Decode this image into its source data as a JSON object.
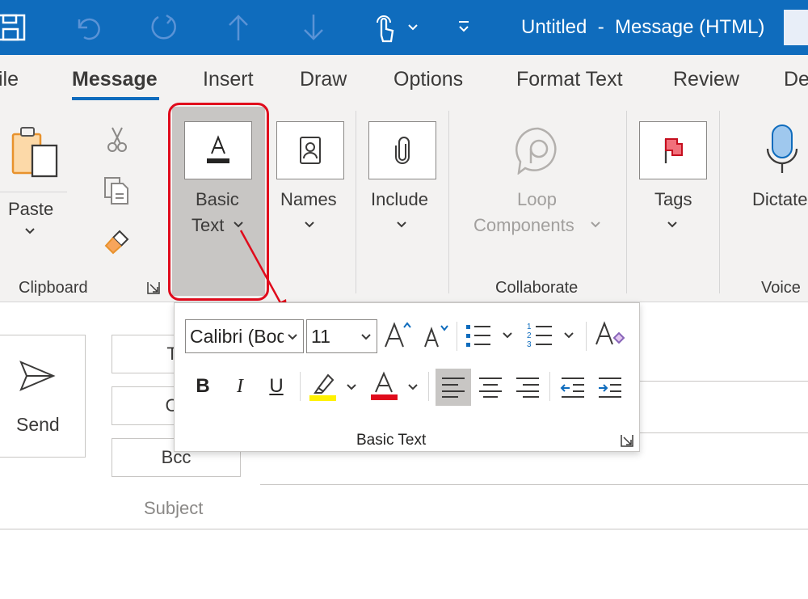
{
  "window": {
    "title": "Untitled  -  Message (HTML)"
  },
  "tabs": [
    {
      "label": "ile",
      "active": false
    },
    {
      "label": "Message",
      "active": true
    },
    {
      "label": "Insert",
      "active": false
    },
    {
      "label": "Draw",
      "active": false
    },
    {
      "label": "Options",
      "active": false
    },
    {
      "label": "Format Text",
      "active": false
    },
    {
      "label": "Review",
      "active": false
    },
    {
      "label": "De",
      "active": false
    }
  ],
  "ribbon": {
    "paste_label": "Paste",
    "clipboard_group": "Clipboard",
    "basic_text_line1": "Basic",
    "basic_text_line2": "Text",
    "names_label": "Names",
    "include_label": "Include",
    "loop_line1": "Loop",
    "loop_line2": "Components",
    "collaborate_group": "Collaborate",
    "tags_label": "Tags",
    "dictate_label": "Dictate",
    "voice_group": "Voice"
  },
  "compose": {
    "send_label": "Send",
    "to_label": "To",
    "cc_label": "Cc",
    "bcc_label": "Bcc",
    "subject_label": "Subject"
  },
  "popup": {
    "font_name": "Calibri (Body)",
    "font_size": "11",
    "group_label": "Basic Text"
  },
  "colors": {
    "titlebar": "#0f6cbd",
    "highlight_ring": "#e00b1c",
    "highlight_color": "#fff100",
    "font_color": "#e00b1c",
    "accent": "#0f6cbd"
  }
}
